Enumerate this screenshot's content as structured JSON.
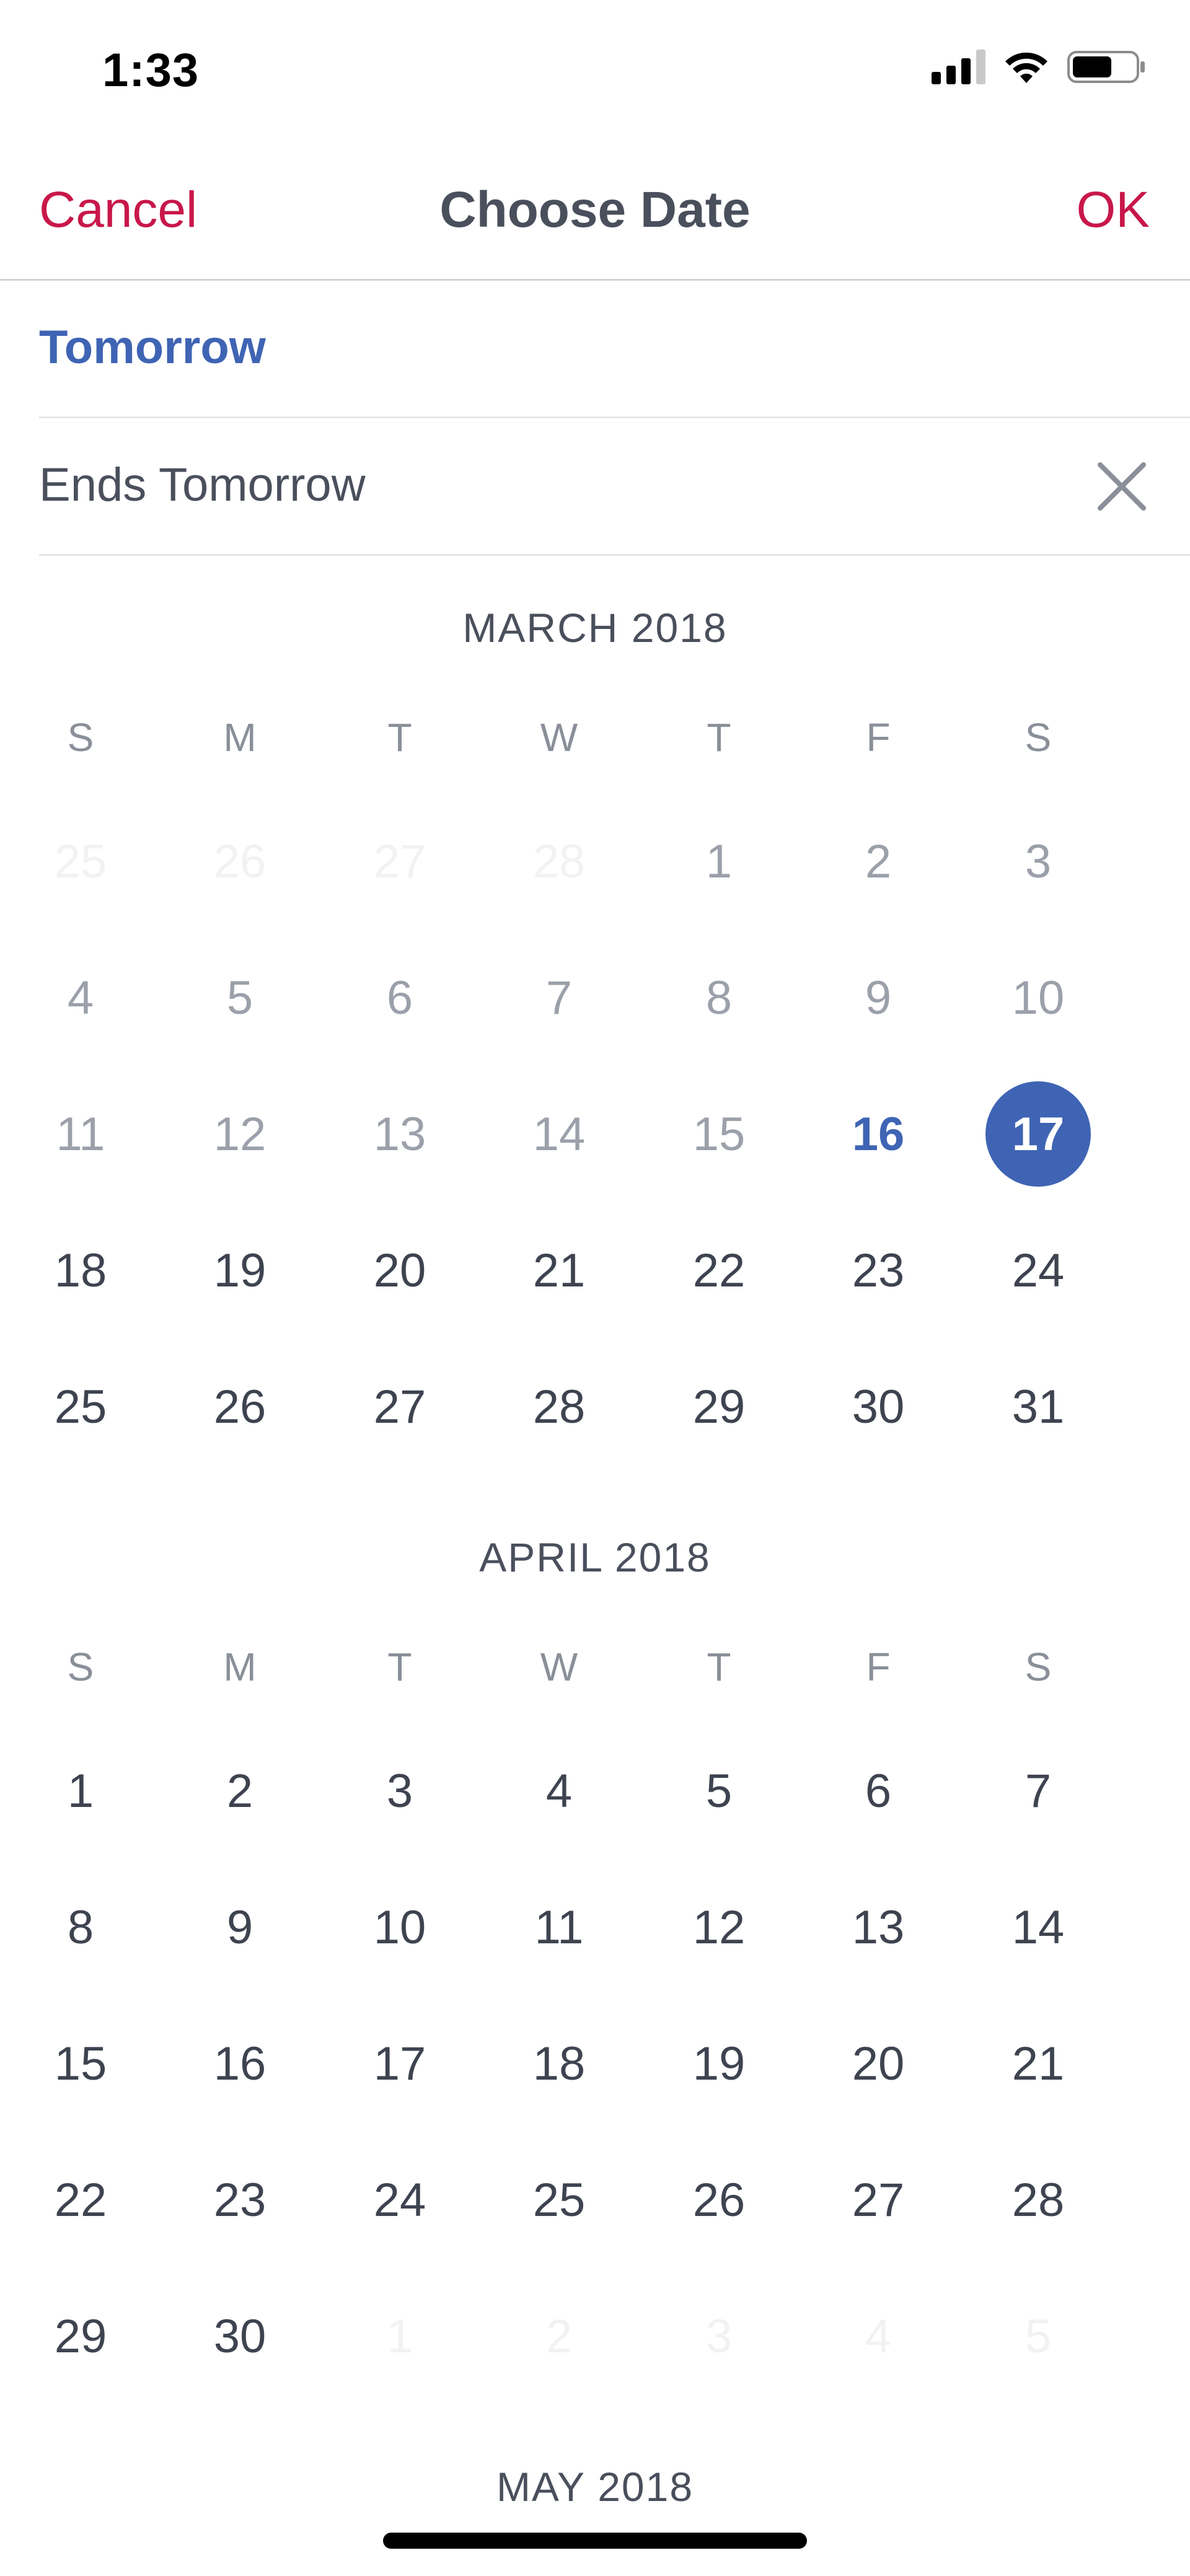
{
  "status_bar": {
    "time": "1:33",
    "icons": [
      "signal-icon",
      "wifi-icon",
      "battery-icon"
    ]
  },
  "nav": {
    "cancel_label": "Cancel",
    "title": "Choose Date",
    "ok_label": "OK"
  },
  "options": {
    "selected_label": "Tomorrow",
    "ends_label": "Ends Tomorrow",
    "clear_icon": "close-icon"
  },
  "colors": {
    "accent_red": "#c8174a",
    "accent_blue": "#3f64b4",
    "text": "#4a4f5c"
  },
  "weekdays": [
    "S",
    "M",
    "T",
    "W",
    "T",
    "F",
    "S"
  ],
  "months": [
    {
      "title": "MARCH 2018",
      "weeks": [
        [
          {
            "d": "25",
            "s": "out"
          },
          {
            "d": "26",
            "s": "out"
          },
          {
            "d": "27",
            "s": "out"
          },
          {
            "d": "28",
            "s": "out"
          },
          {
            "d": "1",
            "s": "past"
          },
          {
            "d": "2",
            "s": "past"
          },
          {
            "d": "3",
            "s": "past"
          }
        ],
        [
          {
            "d": "4",
            "s": "past"
          },
          {
            "d": "5",
            "s": "past"
          },
          {
            "d": "6",
            "s": "past"
          },
          {
            "d": "7",
            "s": "past"
          },
          {
            "d": "8",
            "s": "past"
          },
          {
            "d": "9",
            "s": "past"
          },
          {
            "d": "10",
            "s": "past"
          }
        ],
        [
          {
            "d": "11",
            "s": "past"
          },
          {
            "d": "12",
            "s": "past"
          },
          {
            "d": "13",
            "s": "past"
          },
          {
            "d": "14",
            "s": "past"
          },
          {
            "d": "15",
            "s": "past"
          },
          {
            "d": "16",
            "s": "today"
          },
          {
            "d": "17",
            "s": "selected"
          }
        ],
        [
          {
            "d": "18",
            "s": "normal"
          },
          {
            "d": "19",
            "s": "normal"
          },
          {
            "d": "20",
            "s": "normal"
          },
          {
            "d": "21",
            "s": "normal"
          },
          {
            "d": "22",
            "s": "normal"
          },
          {
            "d": "23",
            "s": "normal"
          },
          {
            "d": "24",
            "s": "normal"
          }
        ],
        [
          {
            "d": "25",
            "s": "normal"
          },
          {
            "d": "26",
            "s": "normal"
          },
          {
            "d": "27",
            "s": "normal"
          },
          {
            "d": "28",
            "s": "normal"
          },
          {
            "d": "29",
            "s": "normal"
          },
          {
            "d": "30",
            "s": "normal"
          },
          {
            "d": "31",
            "s": "normal"
          }
        ]
      ]
    },
    {
      "title": "APRIL 2018",
      "weeks": [
        [
          {
            "d": "1",
            "s": "normal"
          },
          {
            "d": "2",
            "s": "normal"
          },
          {
            "d": "3",
            "s": "normal"
          },
          {
            "d": "4",
            "s": "normal"
          },
          {
            "d": "5",
            "s": "normal"
          },
          {
            "d": "6",
            "s": "normal"
          },
          {
            "d": "7",
            "s": "normal"
          }
        ],
        [
          {
            "d": "8",
            "s": "normal"
          },
          {
            "d": "9",
            "s": "normal"
          },
          {
            "d": "10",
            "s": "normal"
          },
          {
            "d": "11",
            "s": "normal"
          },
          {
            "d": "12",
            "s": "normal"
          },
          {
            "d": "13",
            "s": "normal"
          },
          {
            "d": "14",
            "s": "normal"
          }
        ],
        [
          {
            "d": "15",
            "s": "normal"
          },
          {
            "d": "16",
            "s": "normal"
          },
          {
            "d": "17",
            "s": "normal"
          },
          {
            "d": "18",
            "s": "normal"
          },
          {
            "d": "19",
            "s": "normal"
          },
          {
            "d": "20",
            "s": "normal"
          },
          {
            "d": "21",
            "s": "normal"
          }
        ],
        [
          {
            "d": "22",
            "s": "normal"
          },
          {
            "d": "23",
            "s": "normal"
          },
          {
            "d": "24",
            "s": "normal"
          },
          {
            "d": "25",
            "s": "normal"
          },
          {
            "d": "26",
            "s": "normal"
          },
          {
            "d": "27",
            "s": "normal"
          },
          {
            "d": "28",
            "s": "normal"
          }
        ],
        [
          {
            "d": "29",
            "s": "normal"
          },
          {
            "d": "30",
            "s": "normal"
          },
          {
            "d": "1",
            "s": "out"
          },
          {
            "d": "2",
            "s": "out"
          },
          {
            "d": "3",
            "s": "out"
          },
          {
            "d": "4",
            "s": "out"
          },
          {
            "d": "5",
            "s": "out"
          }
        ]
      ]
    },
    {
      "title": "MAY 2018",
      "weeks": []
    }
  ]
}
